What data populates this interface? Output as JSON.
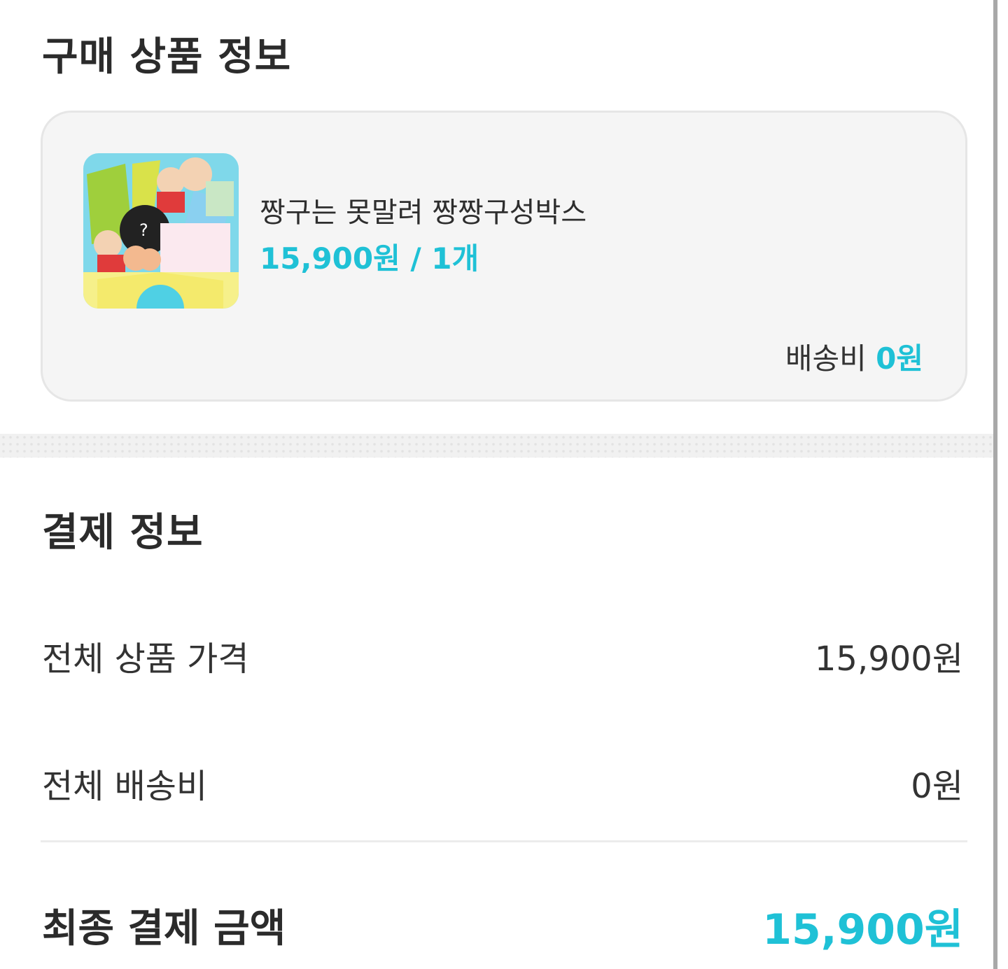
{
  "purchase_section": {
    "title": "구매 상품 정보",
    "product": {
      "name": "짱구는 못말려 짱짱구성박스",
      "price_qty": "15,900원 / 1개",
      "shipping_label": "배송비",
      "shipping_value": "0원"
    }
  },
  "payment_section": {
    "title": "결제 정보",
    "rows": [
      {
        "label": "전체 상품 가격",
        "value": "15,900원"
      },
      {
        "label": "전체 배송비",
        "value": "0원"
      }
    ],
    "final_label": "최종 결제 금액",
    "final_value": "15,900원"
  },
  "colors": {
    "accent": "#1fc1d6",
    "card_bg": "#f5f5f5",
    "text": "#2b2b2b"
  }
}
